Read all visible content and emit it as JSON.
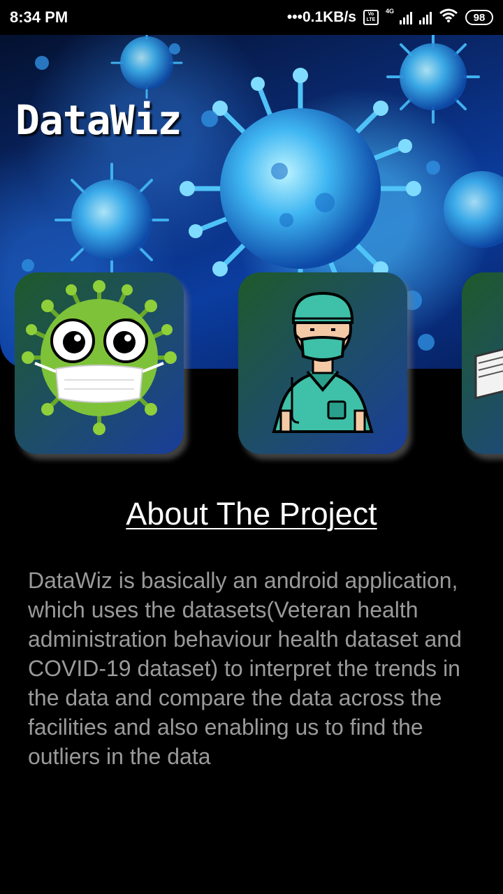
{
  "status_bar": {
    "time": "8:34 PM",
    "net_speed": "•••0.1KB/s",
    "network_tag": "4G",
    "battery": "98",
    "icons": [
      "volte-icon",
      "signal-icon",
      "signal-icon",
      "wifi-icon",
      "battery-icon"
    ]
  },
  "header": {
    "title": "DataWiz"
  },
  "cards": [
    {
      "icon": "virus-mask-icon"
    },
    {
      "icon": "doctor-icon"
    },
    {
      "icon": "dataset-papers-icon"
    }
  ],
  "about": {
    "title": "About The Project",
    "body": "DataWiz is basically an android application, which uses the datasets(Veteran health administration behaviour health dataset and COVID-19 dataset) to interpret the trends in the data and compare the data across the facilities and also enabling us to find the outliers in the data"
  },
  "colors": {
    "background": "#000000",
    "body_text": "#9a9a9a",
    "title_text": "#ffffff",
    "card_gradient_start": "#1e5a2a",
    "card_gradient_end": "#1a3e9a"
  }
}
